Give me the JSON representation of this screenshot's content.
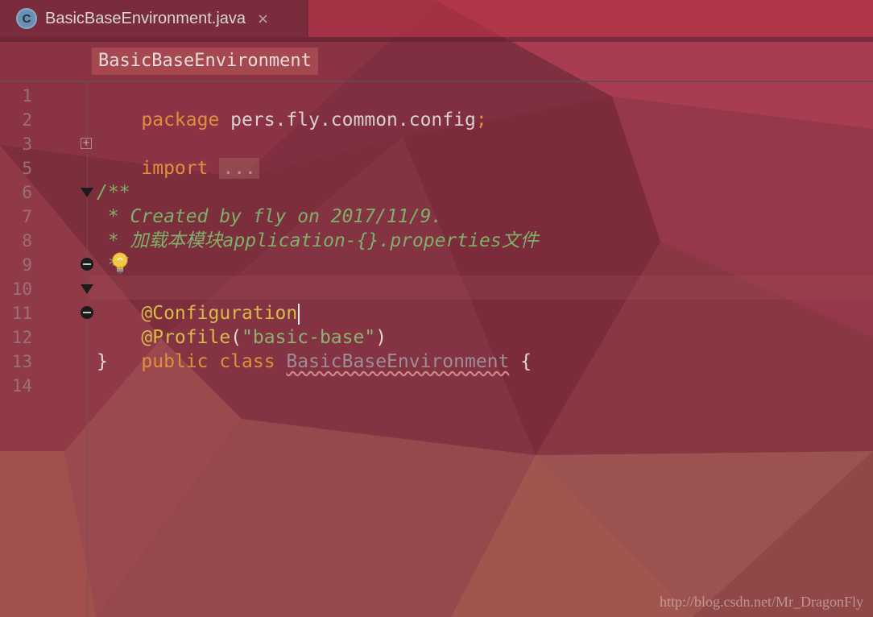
{
  "tab": {
    "icon_letter": "C",
    "title": "BasicBaseEnvironment.java",
    "close": "×"
  },
  "breadcrumb": "BasicBaseEnvironment",
  "line_numbers": [
    "1",
    "2",
    "3",
    "5",
    "6",
    "7",
    "8",
    "9",
    "10",
    "11",
    "12",
    "13",
    "14"
  ],
  "code": {
    "l1_kw": "package",
    "l1_pkg": " pers.fly.common.config",
    "l1_semi": ";",
    "l3_kw": "import",
    "l3_folded": "...",
    "l6": "/**",
    "l7": " * Created by fly on 2017/11/9.",
    "l8": " * 加载本模块application-{}.properties文件",
    "l9": " */",
    "l10": "@Configuration",
    "l11_anno": "@Profile",
    "l11_open": "(",
    "l11_str": "\"basic-base\"",
    "l11_close": ")",
    "l12_kw": "public class",
    "l12_name": "BasicBaseEnvironment",
    "l12_brace": " {",
    "l13": "}"
  },
  "icons": {
    "file_type": "java-class-icon",
    "intention": "lightbulb-icon"
  },
  "colors": {
    "keyword": "#e08f3d",
    "comment": "#7fb069",
    "annotation": "#d8b94a",
    "string": "#8db372"
  },
  "watermark": "http://blog.csdn.net/Mr_DragonFly"
}
